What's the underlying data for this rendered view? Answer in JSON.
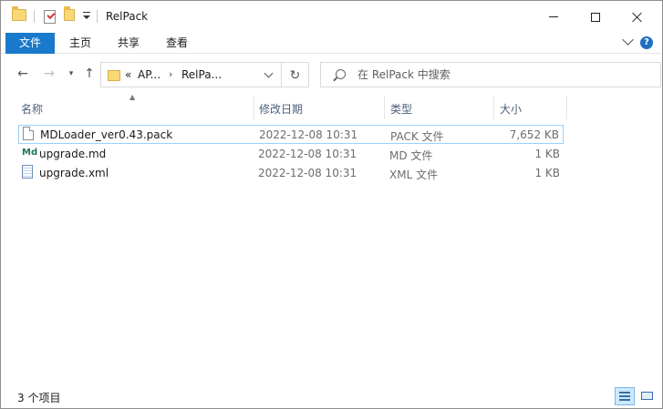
{
  "window": {
    "title": "RelPack"
  },
  "ribbon": {
    "tabs": [
      "文件",
      "主页",
      "共享",
      "查看"
    ]
  },
  "address": {
    "overflow": "«",
    "segments": [
      "AP...",
      "RelPa..."
    ],
    "separator": "›"
  },
  "search": {
    "placeholder": "在 RelPack 中搜索"
  },
  "columns": {
    "name": "名称",
    "date": "修改日期",
    "type": "类型",
    "size": "大小"
  },
  "files": [
    {
      "name": "MDLoader_ver0.43.pack",
      "date": "2022-12-08 10:31",
      "type": "PACK 文件",
      "size": "7,652 KB",
      "icon": "generic-file-icon"
    },
    {
      "name": "upgrade.md",
      "date": "2022-12-08 10:31",
      "type": "MD 文件",
      "size": "1 KB",
      "icon": "markdown-file-icon",
      "icon_text": "Md"
    },
    {
      "name": "upgrade.xml",
      "date": "2022-12-08 10:31",
      "type": "XML 文件",
      "size": "1 KB",
      "icon": "xml-file-icon"
    }
  ],
  "status": {
    "item_count": "3 个项目"
  },
  "colors": {
    "file_tab": "#1979ca",
    "selection_border": "#99d1ff",
    "column_header_text": "#4c607a"
  }
}
